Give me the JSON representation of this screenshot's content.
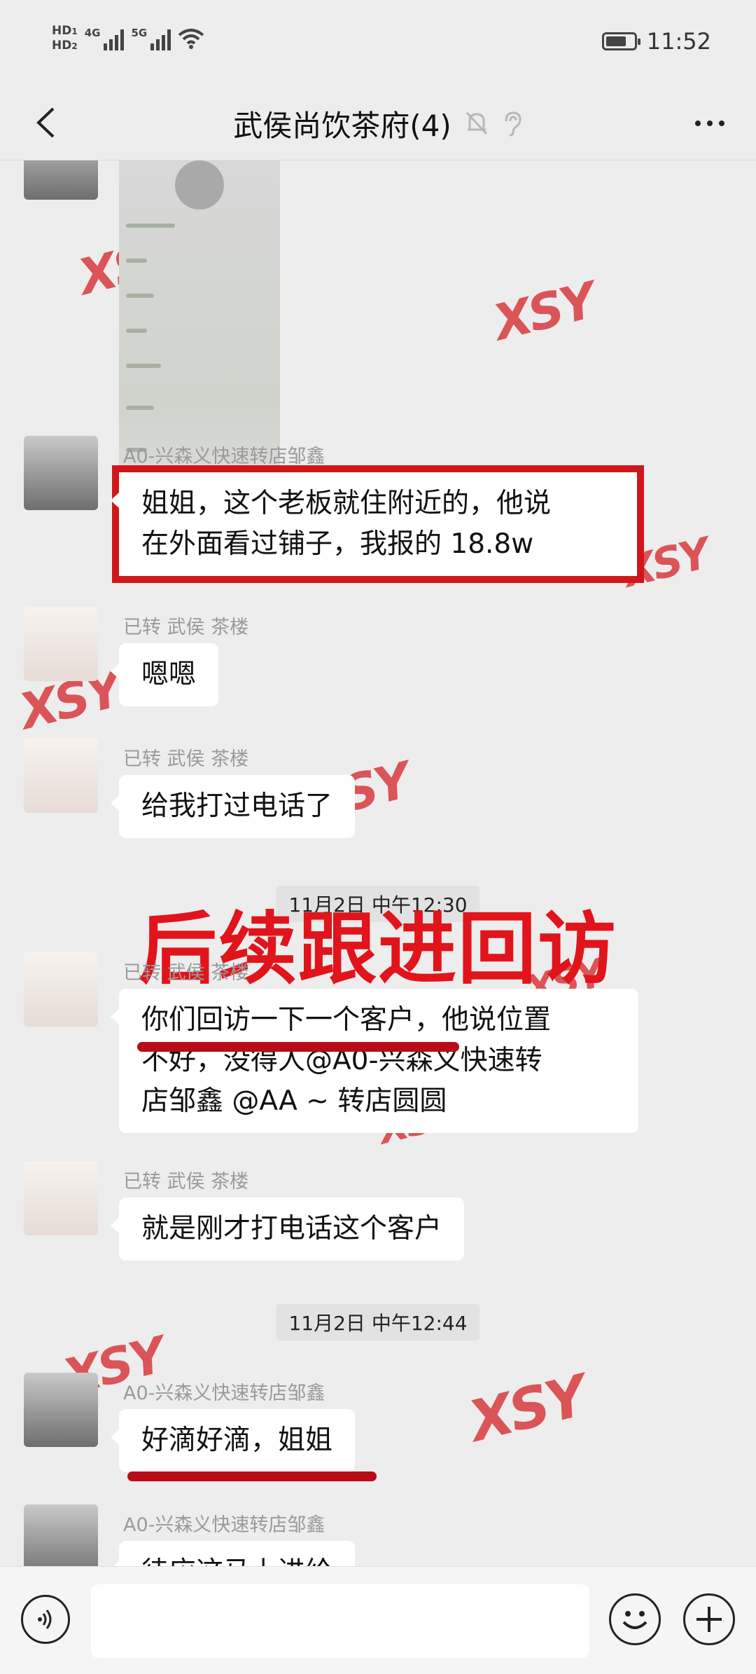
{
  "status_bar": {
    "hd1": "HD",
    "hd1_sub": "1",
    "hd2": "HD",
    "hd2_sub": "2",
    "net1": "4G",
    "net2": "5G",
    "battery_level": 0.75,
    "time": "11:52"
  },
  "nav": {
    "title": "武侯尚饮茶府(4)",
    "icons": [
      "back-icon",
      "bell-muted-icon",
      "ear-icon",
      "more-icon"
    ]
  },
  "messages": [
    {
      "sender": "A0-兴森义快速转店邹鑫",
      "lines": [
        "姐姐，这个老板就住附近的，他说",
        "在外面看过铺子，我报的 18.8w"
      ]
    },
    {
      "sender": "已转 武侯 茶楼",
      "lines": [
        "嗯嗯"
      ]
    },
    {
      "sender": "已转 武侯 茶楼",
      "lines": [
        "给我打过电话了"
      ]
    },
    {
      "sender": "已转 武侯 茶楼",
      "lines": [
        "你们回访一下一个客户，他说位置",
        "不好，没得人@A0-兴森义快速转",
        "店邹鑫 @AA ~ 转店圆圆"
      ]
    },
    {
      "sender": "已转 武侯 茶楼",
      "lines": [
        "就是刚才打电话这个客户"
      ]
    },
    {
      "sender": "A0-兴森义快速转店邹鑫",
      "lines": [
        "好滴好滴，姐姐"
      ]
    },
    {
      "sender": "A0-兴森义快速转店邹鑫",
      "lines": [
        "待应这马上进给"
      ]
    }
  ],
  "timestamps": [
    "11月2日 中午12:30",
    "11月2日 中午12:44"
  ],
  "overlay": {
    "title": "后续跟进回访"
  },
  "watermark": "XSY",
  "input": {
    "placeholder": ""
  },
  "colors": {
    "highlight_red": "#d1161b",
    "overlay_red": "#e1141b",
    "watermark_red": "#d5292e"
  }
}
